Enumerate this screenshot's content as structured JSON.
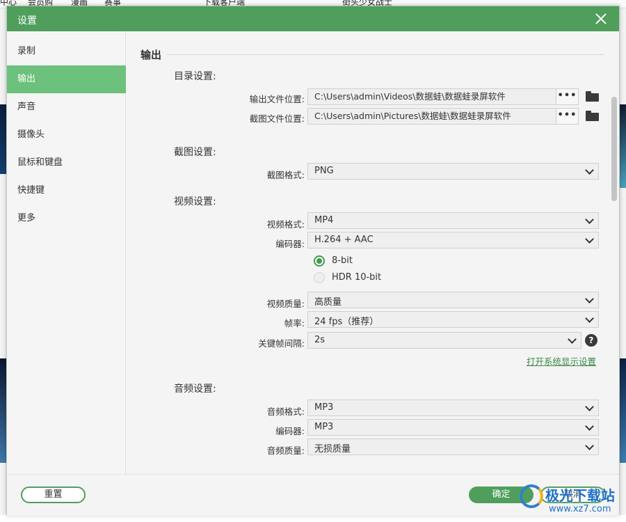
{
  "background": {
    "menu_items": [
      "中心",
      "会员购",
      "漫画",
      "赛事",
      "下载客户端",
      "街头少女战士"
    ]
  },
  "dialog": {
    "title": "设置",
    "close_icon": "close-icon"
  },
  "sidebar": {
    "items": [
      {
        "label": "录制",
        "active": false
      },
      {
        "label": "输出",
        "active": true
      },
      {
        "label": "声音",
        "active": false
      },
      {
        "label": "摄像头",
        "active": false
      },
      {
        "label": "鼠标和键盘",
        "active": false
      },
      {
        "label": "快捷键",
        "active": false
      },
      {
        "label": "更多",
        "active": false
      }
    ]
  },
  "output": {
    "section_title": "输出",
    "directory": {
      "heading": "目录设置:",
      "output_label": "输出文件位置:",
      "output_path": "C:\\Users\\admin\\Videos\\数据蛙\\数据蛙录屏软件",
      "screenshot_label": "截图文件位置:",
      "screenshot_path": "C:\\Users\\admin\\Pictures\\数据蛙\\数据蛙录屏软件",
      "browse_label": "•••"
    },
    "screenshot": {
      "heading": "截图设置:",
      "format_label": "截图格式:",
      "format_value": "PNG"
    },
    "video": {
      "heading": "视频设置:",
      "format_label": "视频格式:",
      "format_value": "MP4",
      "encoder_label": "编码器:",
      "encoder_value": "H.264 + AAC",
      "bitdepth_options": [
        {
          "label": "8-bit",
          "selected": true
        },
        {
          "label": "HDR 10-bit",
          "selected": false
        }
      ],
      "quality_label": "视频质量:",
      "quality_value": "高质量",
      "framerate_label": "帧率:",
      "framerate_value": "24 fps（推荐）",
      "keyframe_label": "关键帧间隔:",
      "keyframe_value": "2s",
      "help_icon": "?",
      "display_settings_link": "打开系统显示设置"
    },
    "audio": {
      "heading": "音频设置:",
      "format_label": "音频格式:",
      "format_value": "MP3",
      "encoder_label": "编码器:",
      "encoder_value": "MP3",
      "quality_label": "音频质量:",
      "quality_value": "无损质量"
    }
  },
  "footer": {
    "reset_label": "重置",
    "ok_label": "确定",
    "cancel_label": "取消"
  },
  "watermark": {
    "title": "极光下载站",
    "url": "www.xz7.com"
  },
  "colors": {
    "accent": "#4f9e5c",
    "sidebar_active": "#6cc17c",
    "link": "#3a8a46"
  }
}
